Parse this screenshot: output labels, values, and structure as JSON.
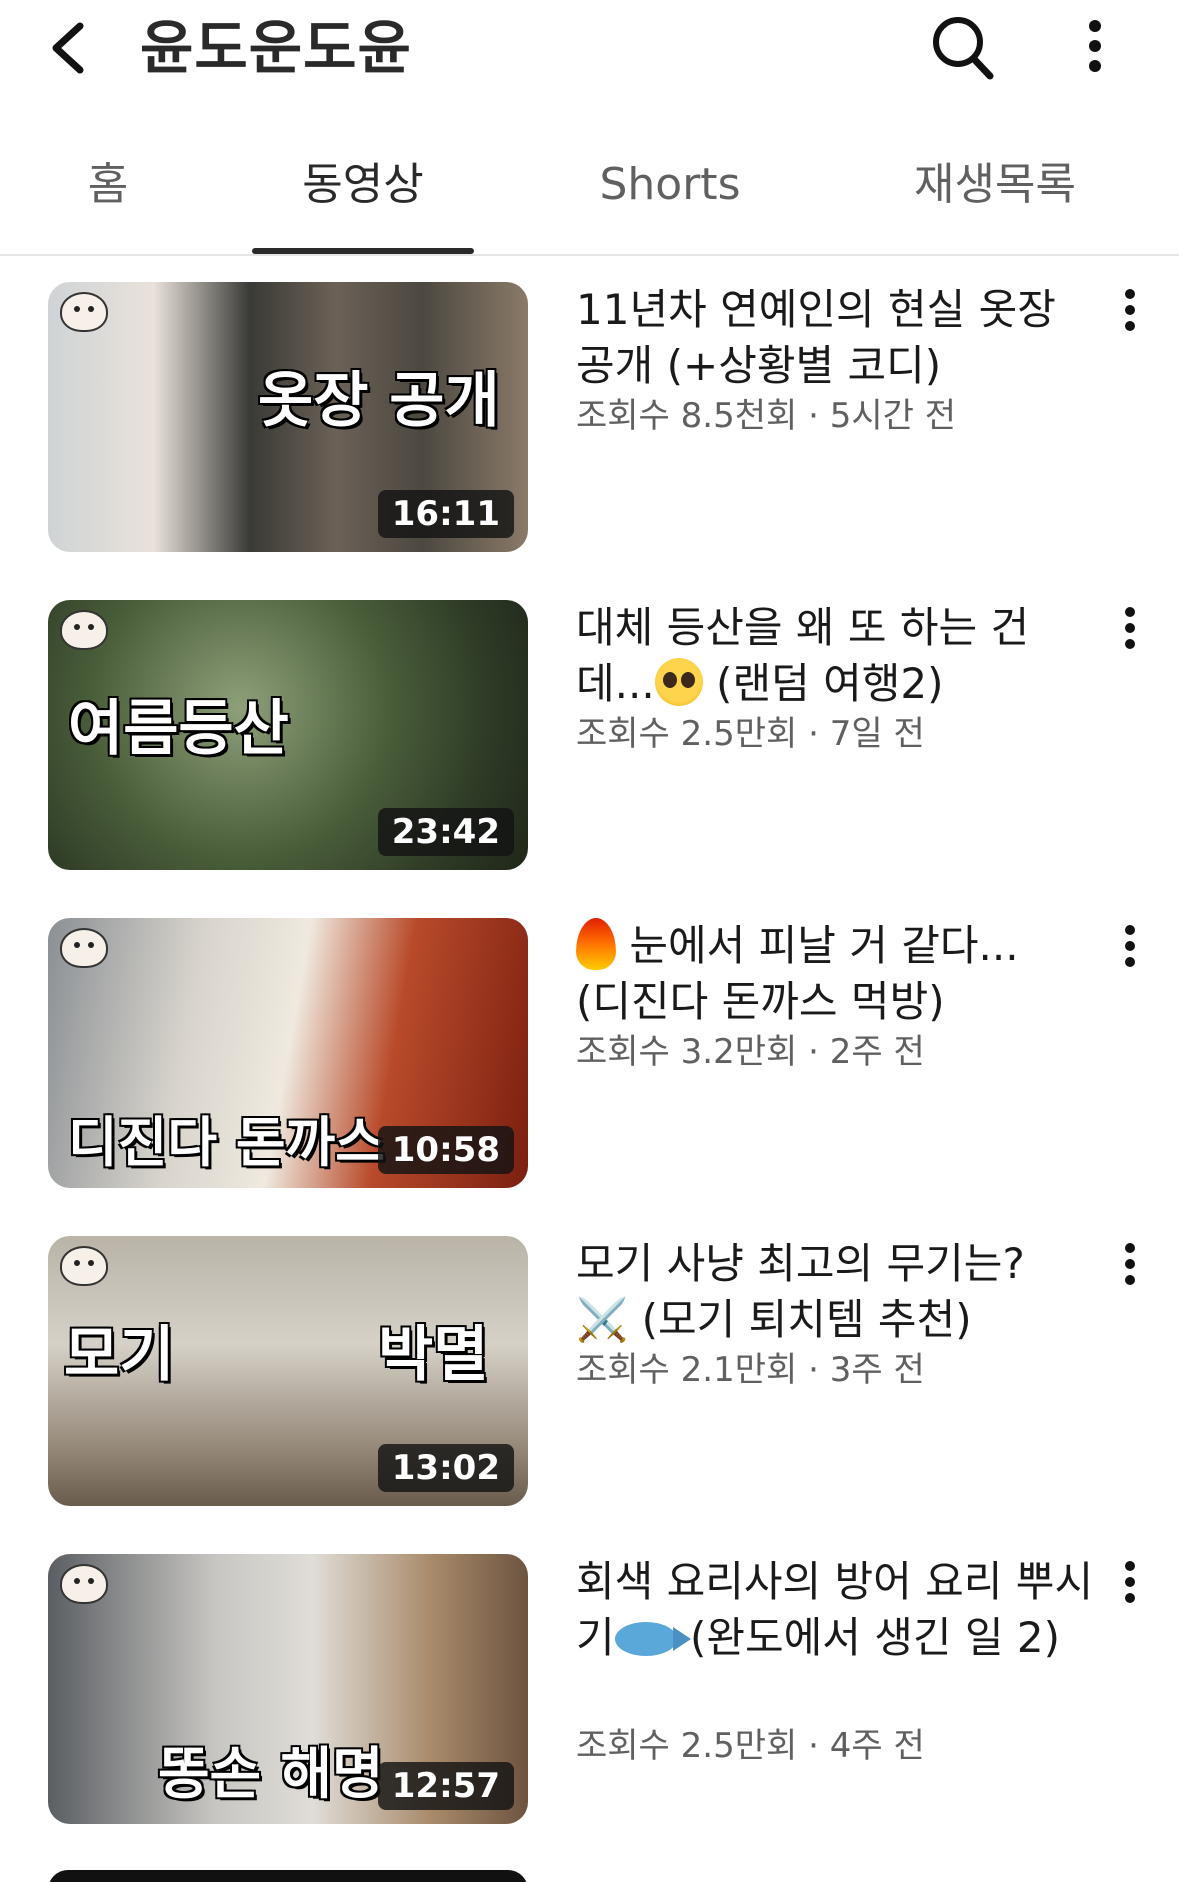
{
  "header": {
    "channel_title": "윤도운도윤"
  },
  "tabs": [
    {
      "label": "홈"
    },
    {
      "label": "동영상"
    },
    {
      "label": "Shorts"
    },
    {
      "label": "재생목록"
    }
  ],
  "videos": [
    {
      "title": "11년차 연예인의 현실 옷장 공개 (+상황별 코디)",
      "views": "조회수 8.5천회",
      "age": "5시간 전",
      "duration": "16:11",
      "overlay_text": "옷장 공개"
    },
    {
      "title_part1": "대체 등산을 왜 또 하는 건데...",
      "title_part2": " (랜덤 여행2)",
      "views": "조회수 2.5만회",
      "age": "7일 전",
      "duration": "23:42",
      "overlay_text": "여름등산"
    },
    {
      "title_part1": " 눈에서 피날 거 같다...",
      "title_part2": "(디진다 돈까스 먹방)",
      "views": "조회수 3.2만회",
      "age": "2주 전",
      "duration": "10:58",
      "overlay_text": "디진다 돈까스"
    },
    {
      "title_part1": "모기 사냥 최고의 무기는?",
      "emoji": "⚔️",
      "title_part2": " (모기 퇴치템 추천)",
      "views": "조회수 2.1만회",
      "age": "3주 전",
      "duration": "13:02",
      "overlay_left": "모기",
      "overlay_right": "박멸"
    },
    {
      "title_part1": "회색 요리사의 방어 요리 뿌시기",
      "title_part2": " (완도에서 생긴 일 2)",
      "views": "조회수 2.5만회",
      "age": "4주 전",
      "duration": "12:57",
      "overlay_text": "똥손 해명"
    }
  ],
  "colors": {
    "text_primary": "#0f0f0f",
    "text_secondary": "#606060",
    "divider": "#e5e5e5"
  }
}
